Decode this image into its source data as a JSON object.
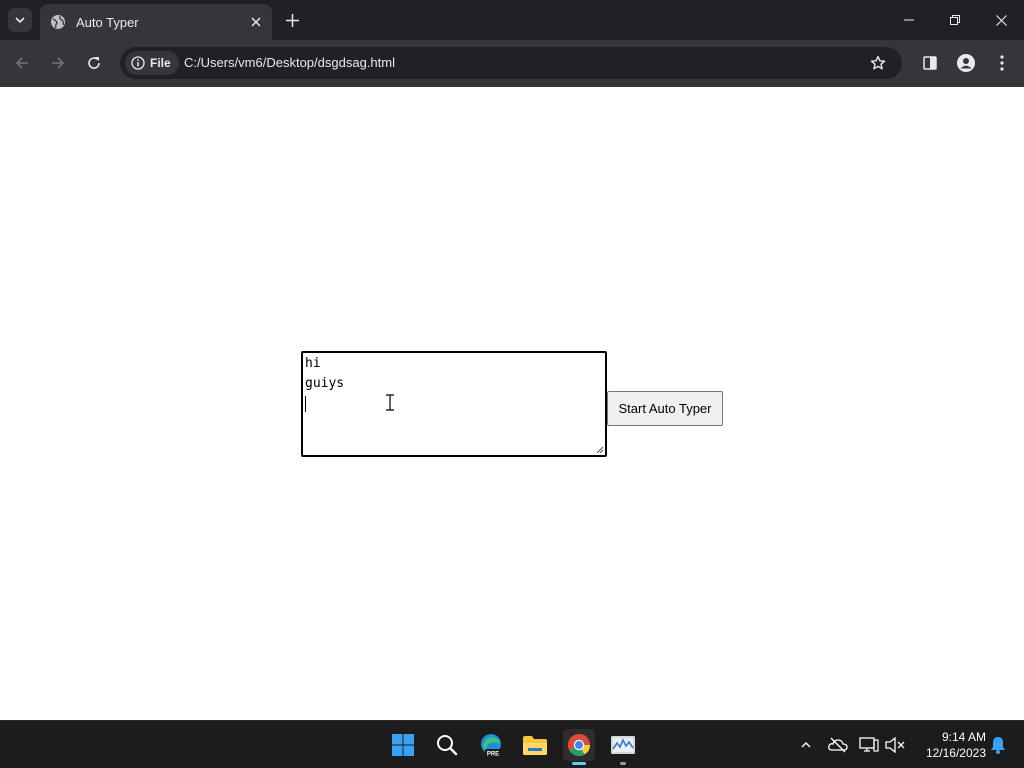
{
  "browser": {
    "tab_title": "Auto Typer",
    "site_info_label": "File",
    "url": "C:/Users/vm6/Desktop/dsgdsag.html"
  },
  "page": {
    "textarea_lines": [
      "hi",
      "guiys",
      ""
    ],
    "start_button_label": "Start Auto Typer"
  },
  "taskbar": {
    "apps": [
      "start-icon",
      "search-icon",
      "edge-preview-icon",
      "file-explorer-icon",
      "chrome-icon",
      "performance-monitor-icon"
    ],
    "edge_badge": "PRE",
    "time": "9:14 AM",
    "date": "12/16/2023"
  },
  "colors": {
    "titlebar": "#202124",
    "toolbar": "#35363a",
    "taskbar": "#1c1c1c",
    "accent": "#60cdff"
  }
}
